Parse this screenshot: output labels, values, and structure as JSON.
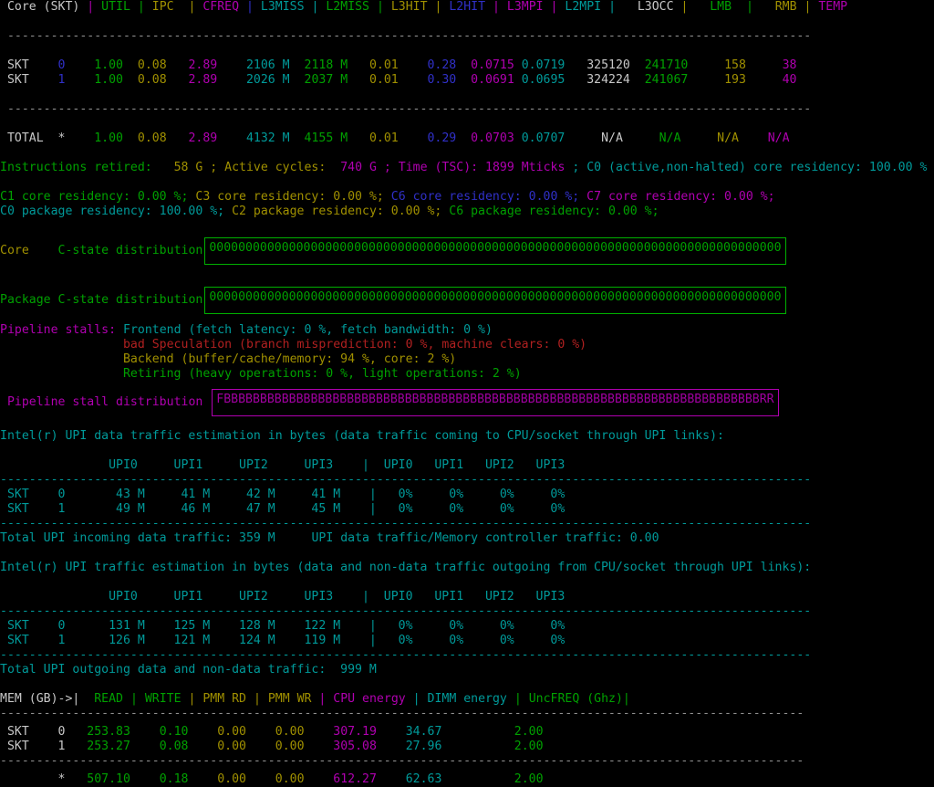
{
  "app": {
    "name": "Intel Performance Counter Monitor",
    "tool": "pcm",
    "terminal_background": "#000000"
  },
  "colors": {
    "green": "#00a000",
    "olive": "#a09000",
    "magenta": "#b000b0",
    "cyan": "#009a9a",
    "blue": "#3030c8",
    "red": "#b02020",
    "white": "#c8c8c8"
  },
  "core_table": {
    "header_cells": [
      "Core (SKT)",
      "UTIL",
      "IPC",
      "CFREQ",
      "L3MISS",
      "L2MISS",
      "L3HIT",
      "L2HIT",
      "L3MPI",
      "L2MPI",
      "L3OCC",
      "LMB",
      "RMB",
      "TEMP"
    ],
    "header_line": "Core (SKT) | UTIL | IPC  | CFREQ | L3MISS | L2MISS | L3HIT | L2HIT | L3MPI | L2MPI |  L3OCC |   LMB  |   RMB | TEMP",
    "separator": "---------------------------------------------------------------------------------------------------------------",
    "rows": [
      {
        "label": "SKT",
        "skt": "0",
        "util": "1.00",
        "ipc": "0.08",
        "cfreq": "2.89",
        "l3miss": "2106 M",
        "l2miss": "2118 M",
        "l3hit": "0.01",
        "l2hit": "0.28",
        "l3mpi": "0.0715",
        "l2mpi": "0.0719",
        "l3occ": "325120",
        "lmb": "241710",
        "rmb": "158",
        "temp": "38"
      },
      {
        "label": "SKT",
        "skt": "1",
        "util": "1.00",
        "ipc": "0.08",
        "cfreq": "2.89",
        "l3miss": "2026 M",
        "l2miss": "2037 M",
        "l3hit": "0.01",
        "l2hit": "0.30",
        "l3mpi": "0.0691",
        "l2mpi": "0.0695",
        "l3occ": "324224",
        "lmb": "241067",
        "rmb": "193",
        "temp": "40"
      }
    ],
    "total": {
      "label": "TOTAL",
      "skt": "*",
      "util": "1.00",
      "ipc": "0.08",
      "cfreq": "2.89",
      "l3miss": "4132 M",
      "l2miss": "4155 M",
      "l3hit": "0.01",
      "l2hit": "0.29",
      "l3mpi": "0.0703",
      "l2mpi": "0.0707",
      "l3occ": "N/A",
      "lmb": "N/A",
      "rmb": "N/A",
      "temp": "N/A"
    }
  },
  "summary": {
    "instructions_retired_label": "Instructions retired:",
    "instructions_retired_value": "58 G",
    "active_cycles_label": "; Active cycles:",
    "active_cycles_value": "740 G",
    "time_tsc_label": "; Time (TSC):",
    "time_tsc_value": "1899 Mticks",
    "c0_label": "; C0 (active,non-halted) core residency:",
    "c0_value": "100.00 %"
  },
  "residency": {
    "core_line": [
      {
        "text": "C1 core residency: 0.00 %;",
        "color": "green"
      },
      {
        "text": "C3 core residency: 0.00 %;",
        "color": "olive"
      },
      {
        "text": "C6 core residency: 0.00 %;",
        "color": "blue"
      },
      {
        "text": "C7 core residency: 0.00 %;",
        "color": "magenta"
      }
    ],
    "package_line": [
      {
        "text": "C0 package residency: 100.00 %;",
        "color": "cyan"
      },
      {
        "text": "C2 package residency: 0.00 %;",
        "color": "olive"
      },
      {
        "text": "C6 package residency: 0.00 %;",
        "color": "green"
      }
    ]
  },
  "cstate_distribution": {
    "core_label": "Core",
    "core_label_suffix": "C-state distribution",
    "core_value": "0000000000000000000000000000000000000000000000000000000000000000000000000000000",
    "package_label": "Package",
    "package_label_suffix": "C-state distribution",
    "package_value": "0000000000000000000000000000000000000000000000000000000000000000000000000000000"
  },
  "pipeline_stalls": {
    "title": "Pipeline stalls:",
    "lines": [
      {
        "text": "Frontend (fetch latency: 0 %, fetch bandwidth: 0 %)",
        "color": "cyan"
      },
      {
        "text": "bad Speculation (branch misprediction: 0 %, machine clears: 0 %)",
        "color": "red"
      },
      {
        "text": "Backend (buffer/cache/memory: 94 %, core: 2 %)",
        "color": "olive"
      },
      {
        "text": "Retiring (heavy operations: 0 %, light operations: 2 %)",
        "color": "green"
      }
    ],
    "distribution_label": "Pipeline stall distribution",
    "distribution_value": "FBBBBBBBBBBBBBBBBBBBBBBBBBBBBBBBBBBBBBBBBBBBBBBBBBBBBBBBBBBBBBBBBBBBBBBBBBBRR"
  },
  "upi_incoming": {
    "title": "Intel(r) UPI data traffic estimation in bytes (data traffic coming to CPU/socket through UPI links):",
    "header": "               UPI0     UPI1     UPI2     UPI3    |  UPI0   UPI1   UPI2   UPI3",
    "separator": "----------------------------------------------------------------------------------------------------------------",
    "columns": [
      "UPI0",
      "UPI1",
      "UPI2",
      "UPI3",
      "UPI0",
      "UPI1",
      "UPI2",
      "UPI3"
    ],
    "rows": [
      {
        "label": "SKT",
        "skt": "0",
        "bytes": [
          "43 M",
          "41 M",
          "42 M",
          "41 M"
        ],
        "pct": [
          "0%",
          "0%",
          "0%",
          "0%"
        ]
      },
      {
        "label": "SKT",
        "skt": "1",
        "bytes": [
          "49 M",
          "46 M",
          "47 M",
          "45 M"
        ],
        "pct": [
          "0%",
          "0%",
          "0%",
          "0%"
        ]
      }
    ],
    "total_label": "Total UPI incoming data traffic:",
    "total_value": "359 M",
    "ratio_label": "UPI data traffic/Memory controller traffic:",
    "ratio_value": "0.00"
  },
  "upi_outgoing": {
    "title": "Intel(r) UPI traffic estimation in bytes (data and non-data traffic outgoing from CPU/socket through UPI links):",
    "header": "               UPI0     UPI1     UPI2     UPI3    |  UPI0   UPI1   UPI2   UPI3",
    "separator": "----------------------------------------------------------------------------------------------------------------",
    "rows": [
      {
        "label": "SKT",
        "skt": "0",
        "bytes": [
          "131 M",
          "125 M",
          "128 M",
          "122 M"
        ],
        "pct": [
          "0%",
          "0%",
          "0%",
          "0%"
        ]
      },
      {
        "label": "SKT",
        "skt": "1",
        "bytes": [
          "126 M",
          "121 M",
          "124 M",
          "119 M"
        ],
        "pct": [
          "0%",
          "0%",
          "0%",
          "0%"
        ]
      }
    ],
    "total_label": "Total UPI outgoing data and non-data traffic:",
    "total_value": "999 M"
  },
  "mem_table": {
    "header_prefix": "MEM (GB)->|",
    "header_cells": [
      "READ",
      "WRITE",
      "PMM RD",
      "PMM WR",
      "CPU energy",
      "DIMM energy",
      "UncFREQ (Ghz)"
    ],
    "separator": "---------------------------------------------------------------------------------------------------------------",
    "rows": [
      {
        "label": "SKT",
        "skt": "0",
        "read": "253.83",
        "write": "0.10",
        "pmm_rd": "0.00",
        "pmm_wr": "0.00",
        "cpu_energy": "307.19",
        "dimm_energy": "34.67",
        "uncfreq": "2.00"
      },
      {
        "label": "SKT",
        "skt": "1",
        "read": "253.27",
        "write": "0.08",
        "pmm_rd": "0.00",
        "pmm_wr": "0.00",
        "cpu_energy": "305.08",
        "dimm_energy": "27.96",
        "uncfreq": "2.00"
      }
    ],
    "total": {
      "label": "",
      "skt": "*",
      "read": "507.10",
      "write": "0.18",
      "pmm_rd": "0.00",
      "pmm_wr": "0.00",
      "cpu_energy": "612.27",
      "dimm_energy": "62.63",
      "uncfreq": "2.00"
    }
  }
}
